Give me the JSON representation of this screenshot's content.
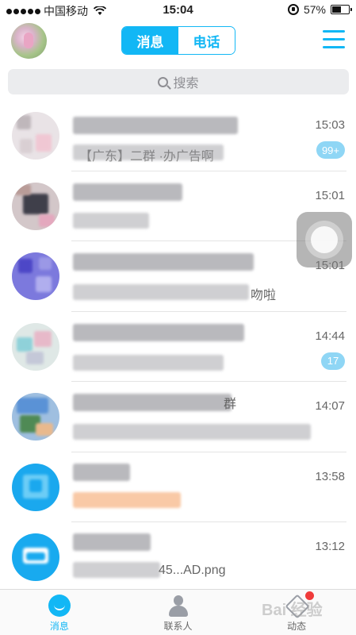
{
  "status_bar": {
    "carrier": "中国移动",
    "time": "15:04",
    "battery_text": "57%",
    "battery_level": 0.57
  },
  "header": {
    "tabs": [
      {
        "label": "消息",
        "active": true
      },
      {
        "label": "电话",
        "active": false
      }
    ]
  },
  "search": {
    "placeholder": "搜索"
  },
  "conversations": [
    {
      "time": "15:03",
      "badge": "99+",
      "snippet_visible": "【广东】二群 ·办广告啊"
    },
    {
      "time": "15:01",
      "badge": "",
      "snippet_visible": ""
    },
    {
      "time": "15:01",
      "badge": "",
      "snippet_visible": "吻啦"
    },
    {
      "time": "14:44",
      "badge": "17",
      "snippet_visible": ""
    },
    {
      "time": "14:07",
      "badge": "",
      "snippet_visible": "群"
    },
    {
      "time": "13:58",
      "badge": "",
      "snippet_visible": ""
    },
    {
      "time": "13:12",
      "badge": "",
      "snippet_visible": "45...AD.png"
    }
  ],
  "tabbar": {
    "items": [
      {
        "label": "消息",
        "icon": "message-icon",
        "active": true
      },
      {
        "label": "联系人",
        "icon": "contacts-icon",
        "active": false
      },
      {
        "label": "动态",
        "icon": "feed-icon",
        "active": false
      }
    ]
  },
  "watermark": "Bai 经验",
  "colors": {
    "accent": "#12b7f5",
    "badge": "#8fd6f5",
    "notification_dot": "#f03b3b"
  }
}
